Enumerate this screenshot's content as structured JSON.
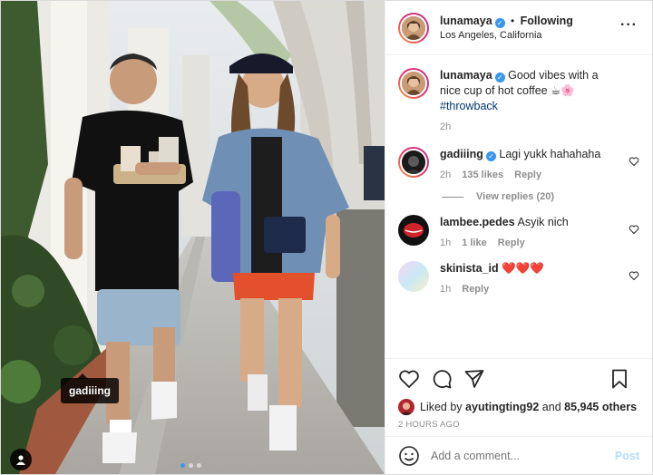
{
  "photo": {
    "tag_label": "gadiiing",
    "carousel_count": 3,
    "carousel_active": 1
  },
  "header": {
    "username": "lunamaya",
    "separator": "•",
    "follow_status": "Following",
    "location": "Los Angeles, California",
    "more_icon": "more-horizontal-icon"
  },
  "caption": {
    "username": "lunamaya",
    "text": "Good vibes with a nice cup of hot coffee ☕🌸",
    "hashtag": "#throwback",
    "time": "2h"
  },
  "comments": [
    {
      "username": "gadiiing",
      "verified": true,
      "text": "Lagi yukk hahahaha",
      "time": "2h",
      "likes": "135 likes",
      "reply": "Reply"
    },
    {
      "username": "lambee.pedes",
      "verified": false,
      "text": "Asyik nich",
      "time": "1h",
      "likes": "1 like",
      "reply": "Reply"
    },
    {
      "username": "skinista_id",
      "verified": false,
      "text": "❤️❤️❤️",
      "time": "1h",
      "likes": "",
      "reply": "Reply"
    }
  ],
  "view_replies": "View replies (20)",
  "likes": {
    "prefix": "Liked by",
    "first_user": "ayutingting92",
    "middle": "and",
    "others": "85,945 others"
  },
  "time_ago": "2 HOURS AGO",
  "add_comment": {
    "placeholder": "Add a comment...",
    "post_label": "Post"
  },
  "colors": {
    "accent": "#3897f0",
    "post_disabled": "#b2dffc",
    "heart_red": "#ed4956"
  }
}
